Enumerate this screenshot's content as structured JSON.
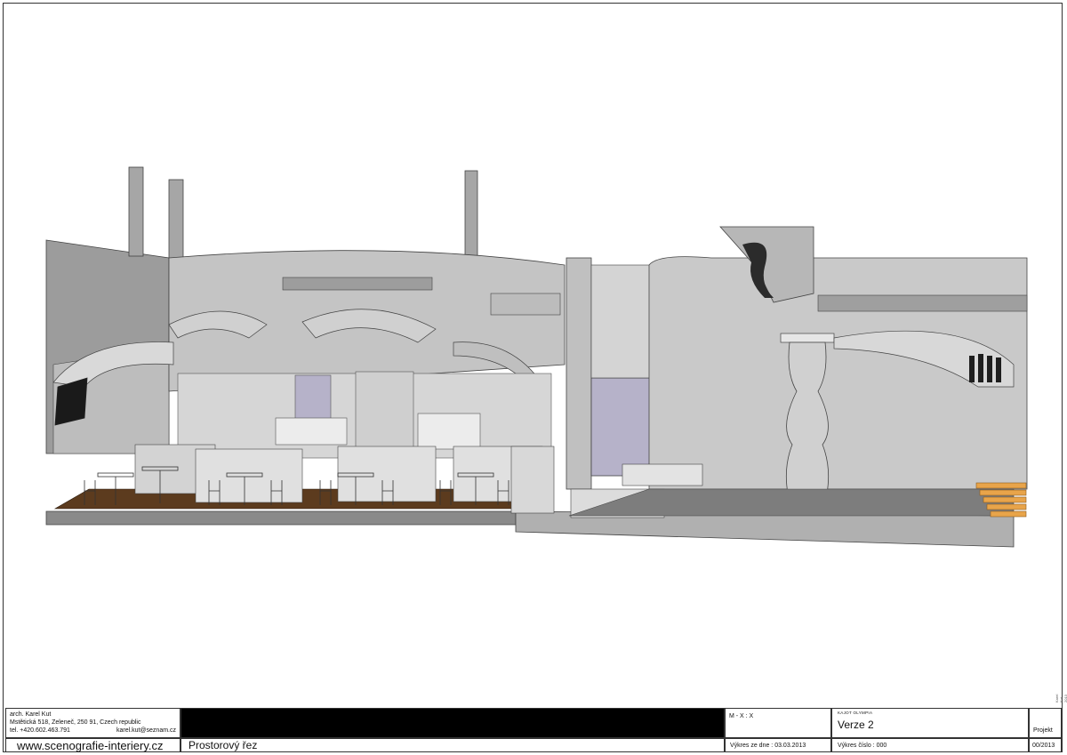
{
  "author": {
    "name": "arch. Karel Kut",
    "address": "Mstětická 518, Zeleneč, 250 91, Czech republic",
    "phone": "tel. +420.602.463.791",
    "email": "karel.kut@seznam.cz",
    "website": "www.scenografie-interiery.cz"
  },
  "drawing": {
    "title": "Prostorový řez",
    "scale": "M - X : X",
    "date": "Výkres ze dne : 03.03.2013",
    "client": "KAJOT OLYMPIA",
    "version": "Verze 2",
    "number": "Výkres číslo : 000",
    "project_label": "Projekt",
    "project_code": "00/2013",
    "copyright": "Karel Kut 2013"
  },
  "colors": {
    "wall": "#c8c8c8",
    "wall_dark": "#9a9a9a",
    "floor": "#5c3b1e",
    "stairs": "#e8a44a",
    "glass": "#b6b2c9"
  }
}
